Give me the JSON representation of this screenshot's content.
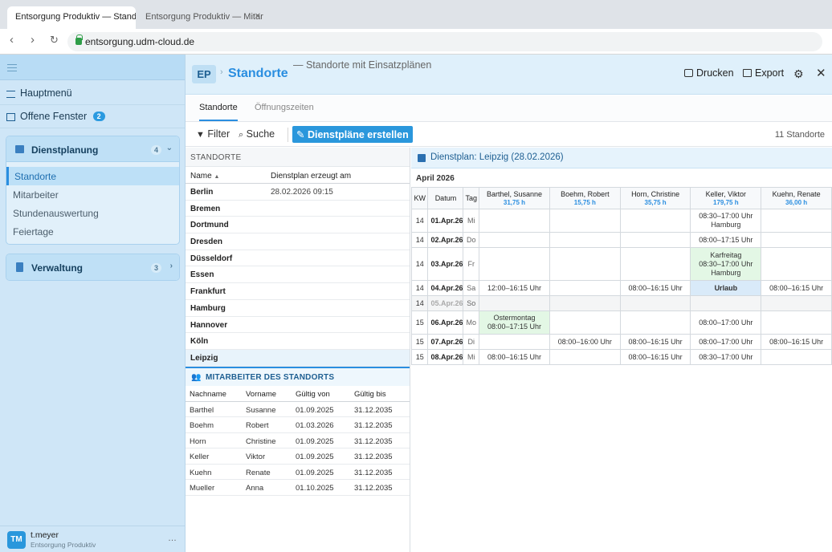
{
  "browser": {
    "tabs": [
      {
        "title": "Entsorgung Produktiv — Stand…",
        "active": true
      },
      {
        "title": "Entsorgung Produktiv — Mitar…",
        "active": false
      }
    ],
    "url": "entsorgung.udm-cloud.de"
  },
  "sidebar": {
    "hauptmenu": "Hauptmenü",
    "offene_fenster": "Offene Fenster",
    "offene_count": "2",
    "groups": [
      {
        "label": "Dienstplanung",
        "count": "4",
        "items": [
          "Standorte",
          "Mitarbeiter",
          "Stundenauswertung",
          "Feiertage"
        ],
        "selected": "Standorte"
      },
      {
        "label": "Verwaltung",
        "count": "3"
      }
    ],
    "user": {
      "initials": "TM",
      "name": "t.meyer",
      "org": "Entsorgung Produktiv",
      "more": "…"
    }
  },
  "header": {
    "badge": "EP",
    "title": "Standorte",
    "subtitle": "— Standorte mit Einsatzplänen",
    "print": "Drucken",
    "export": "Export"
  },
  "tabs": [
    "Standorte",
    "Öffnungszeiten"
  ],
  "toolbar": {
    "filter": "Filter",
    "search": "Suche",
    "create": "Dienstpläne erstellen",
    "count": "11 Standorte"
  },
  "standorte": {
    "section_title": "STANDORTE",
    "col_name": "Name",
    "col_created": "Dienstplan erzeugt am",
    "rows": [
      {
        "name": "Berlin",
        "created": "28.02.2026 09:15"
      },
      {
        "name": "Bremen",
        "created": ""
      },
      {
        "name": "Dortmund",
        "created": ""
      },
      {
        "name": "Dresden",
        "created": ""
      },
      {
        "name": "Düsseldorf",
        "created": ""
      },
      {
        "name": "Essen",
        "created": ""
      },
      {
        "name": "Frankfurt",
        "created": ""
      },
      {
        "name": "Hamburg",
        "created": ""
      },
      {
        "name": "Hannover",
        "created": ""
      },
      {
        "name": "Köln",
        "created": ""
      },
      {
        "name": "Leipzig",
        "created": ""
      }
    ],
    "selected": "Leipzig"
  },
  "mitarbeiter": {
    "title": "MITARBEITER DES STANDORTS",
    "cols": [
      "Nachname",
      "Vorname",
      "Gültig von",
      "Gültig bis"
    ],
    "rows": [
      [
        "Barthel",
        "Susanne",
        "01.09.2025",
        "31.12.2035"
      ],
      [
        "Boehm",
        "Robert",
        "01.03.2026",
        "31.12.2035"
      ],
      [
        "Horn",
        "Christine",
        "01.09.2025",
        "31.12.2035"
      ],
      [
        "Keller",
        "Viktor",
        "01.09.2025",
        "31.12.2035"
      ],
      [
        "Kuehn",
        "Renate",
        "01.09.2025",
        "31.12.2035"
      ],
      [
        "Mueller",
        "Anna",
        "01.10.2025",
        "31.12.2035"
      ]
    ]
  },
  "dienstplan": {
    "title": "Dienstplan: Leipzig (28.02.2026)",
    "month": "April 2026",
    "col_kw": "KW",
    "col_datum": "Datum",
    "col_tag": "Tag",
    "employees": [
      {
        "name": "Barthel, Susanne",
        "hours": "31,75 h"
      },
      {
        "name": "Boehm, Robert",
        "hours": "15,75 h"
      },
      {
        "name": "Horn, Christine",
        "hours": "35,75 h"
      },
      {
        "name": "Keller, Viktor",
        "hours": "179,75 h"
      },
      {
        "name": "Kuehn, Renate",
        "hours": "36,00 h"
      }
    ],
    "rows": [
      {
        "kw": "14",
        "date": "01.Apr.26",
        "day": "Mi",
        "cells": [
          null,
          null,
          null,
          {
            "lines": [
              "08:30–17:00 Uhr",
              "Hamburg"
            ]
          },
          null
        ]
      },
      {
        "kw": "14",
        "date": "02.Apr.26",
        "day": "Do",
        "cells": [
          null,
          null,
          null,
          {
            "lines": [
              "08:00–17:15 Uhr"
            ]
          },
          null
        ]
      },
      {
        "kw": "14",
        "date": "03.Apr.26",
        "day": "Fr",
        "cells": [
          null,
          null,
          null,
          {
            "lines": [
              "Karfreitag",
              "08:30–17:00 Uhr",
              "Hamburg"
            ],
            "type": "holiday"
          },
          null
        ]
      },
      {
        "kw": "14",
        "date": "04.Apr.26",
        "day": "Sa",
        "cells": [
          {
            "lines": [
              "12:00–16:15 Uhr"
            ]
          },
          null,
          {
            "lines": [
              "08:00–16:15 Uhr"
            ]
          },
          {
            "lines": [
              "Urlaub"
            ],
            "type": "vacation"
          },
          {
            "lines": [
              "08:00–16:15 Uhr"
            ]
          }
        ]
      },
      {
        "kw": "14",
        "date": "05.Apr.26",
        "day": "So",
        "off": true,
        "cells": [
          null,
          null,
          null,
          null,
          null
        ]
      },
      {
        "kw": "15",
        "date": "06.Apr.26",
        "day": "Mo",
        "cells": [
          {
            "lines": [
              "Ostermontag",
              "08:00–17:15 Uhr"
            ],
            "type": "holiday"
          },
          null,
          null,
          {
            "lines": [
              "08:00–17:00 Uhr"
            ]
          },
          null
        ]
      },
      {
        "kw": "15",
        "date": "07.Apr.26",
        "day": "Di",
        "cells": [
          null,
          {
            "lines": [
              "08:00–16:00 Uhr"
            ]
          },
          {
            "lines": [
              "08:00–16:15 Uhr"
            ]
          },
          {
            "lines": [
              "08:00–17:00 Uhr"
            ]
          },
          {
            "lines": [
              "08:00–16:15 Uhr"
            ]
          }
        ]
      },
      {
        "kw": "15",
        "date": "08.Apr.26",
        "day": "Mi",
        "cells": [
          {
            "lines": [
              "08:00–16:15 Uhr"
            ]
          },
          null,
          {
            "lines": [
              "08:00–16:15 Uhr"
            ]
          },
          {
            "lines": [
              "08:30–17:00 Uhr"
            ]
          },
          null
        ]
      }
    ]
  }
}
